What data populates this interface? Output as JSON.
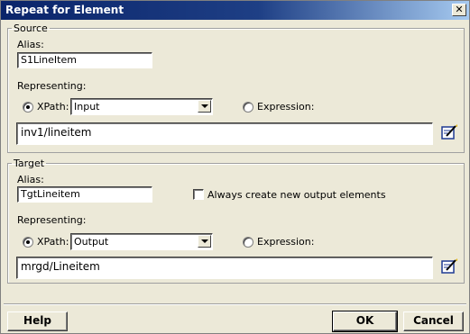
{
  "window": {
    "title": "Repeat for Element",
    "close_glyph": "✕"
  },
  "source": {
    "legend": "Source",
    "alias_label": "Alias:",
    "alias_value": "S1LineItem",
    "representing_label": "Representing:",
    "xpath_label": "XPath:",
    "xpath_value": "Input",
    "expression_label": "Expression:",
    "selected": "xpath",
    "path_value": "inv1/lineitem"
  },
  "target": {
    "legend": "Target",
    "alias_label": "Alias:",
    "alias_value": "TgtLineitem",
    "always_create_label": "Always create new output elements",
    "always_create_checked": false,
    "representing_label": "Representing:",
    "xpath_label": "XPath:",
    "xpath_value": "Output",
    "expression_label": "Expression:",
    "selected": "xpath",
    "path_value": "mrgd/Lineitem"
  },
  "buttons": {
    "help": "Help",
    "ok": "OK",
    "cancel": "Cancel"
  },
  "icons": {
    "edit": "edit-pencil-icon",
    "dropdown": "chevron-down-icon",
    "close": "close-icon"
  }
}
